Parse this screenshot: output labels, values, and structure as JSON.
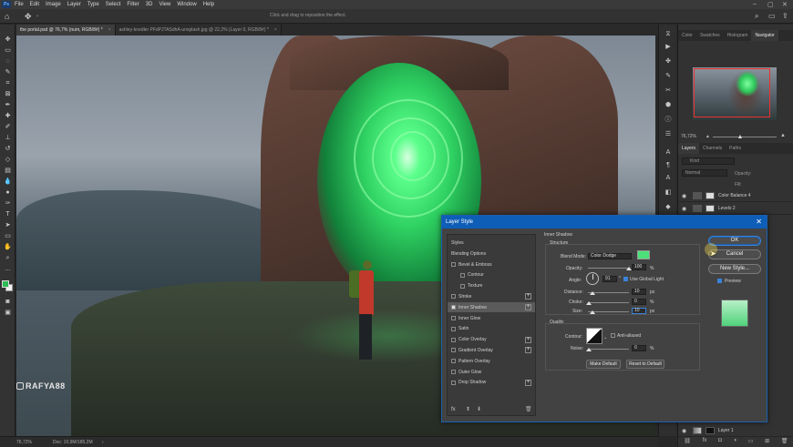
{
  "menubar": {
    "logo": "Ps",
    "items": [
      "File",
      "Edit",
      "Image",
      "Layer",
      "Type",
      "Select",
      "Filter",
      "3D",
      "View",
      "Window",
      "Help"
    ]
  },
  "options": {
    "hint": "Click and drag to reposition the effect."
  },
  "tabs": [
    {
      "label": "the portal.psd @ 76,7% (num, RGB/8#) *",
      "active": true
    },
    {
      "label": "ashley-knedler PFdPJTASdhA-unsplash.jpg @ 22,2% (Layer 0, RGB/8#) *",
      "active": false
    }
  ],
  "canvas": {
    "watermark": "RAFYA88"
  },
  "status": {
    "zoom": "76,72%",
    "doc": "Doc: 10,9M/185,2M"
  },
  "panels": {
    "top_tabs": [
      "Color",
      "Swatches",
      "Histogram",
      "Navigator"
    ],
    "nav_zoom": "76,72%",
    "layer_tabs": [
      "Layers",
      "Channels",
      "Paths"
    ],
    "search_placeholder": "Kind",
    "blend_mode": "Normal",
    "opacity_label": "Opacity:",
    "fill_label": "Fill:",
    "layers": [
      {
        "name": "Color Balance 4"
      },
      {
        "name": "Levels 2"
      },
      {
        "name": "Layer 1"
      }
    ]
  },
  "dialog": {
    "title": "Layer Style",
    "styles_header": "Styles",
    "blending_options": "Blending Options",
    "items": [
      {
        "label": "Bevel & Emboss",
        "plus": false,
        "indent": false,
        "checked": false,
        "selected": false
      },
      {
        "label": "Contour",
        "plus": false,
        "indent": true,
        "checked": false,
        "selected": false
      },
      {
        "label": "Texture",
        "plus": false,
        "indent": true,
        "checked": false,
        "selected": false
      },
      {
        "label": "Stroke",
        "plus": true,
        "indent": false,
        "checked": false,
        "selected": false
      },
      {
        "label": "Inner Shadow",
        "plus": true,
        "indent": false,
        "checked": true,
        "selected": true
      },
      {
        "label": "Inner Glow",
        "plus": false,
        "indent": false,
        "checked": false,
        "selected": false
      },
      {
        "label": "Satin",
        "plus": false,
        "indent": false,
        "checked": false,
        "selected": false
      },
      {
        "label": "Color Overlay",
        "plus": true,
        "indent": false,
        "checked": false,
        "selected": false
      },
      {
        "label": "Gradient Overlay",
        "plus": true,
        "indent": false,
        "checked": false,
        "selected": false
      },
      {
        "label": "Pattern Overlay",
        "plus": false,
        "indent": false,
        "checked": false,
        "selected": false
      },
      {
        "label": "Outer Glow",
        "plus": false,
        "indent": false,
        "checked": false,
        "selected": false
      },
      {
        "label": "Drop Shadow",
        "plus": true,
        "indent": false,
        "checked": false,
        "selected": false
      }
    ],
    "fx": "fx",
    "inner_shadow": {
      "title": "Inner Shadow",
      "structure": "Structure",
      "blend_mode_label": "Blend Mode:",
      "blend_mode": "Color Dodge",
      "color": "#4de07a",
      "opacity_label": "Opacity:",
      "opacity": "100",
      "angle_label": "Angle:",
      "angle": "91",
      "use_global_light": "Use Global Light",
      "distance_label": "Distance:",
      "distance": "10",
      "choke_label": "Choke:",
      "choke": "0",
      "size_label": "Size:",
      "size": "10",
      "unit_percent": "%",
      "unit_px": "px",
      "quality": "Quality",
      "contour_label": "Contour:",
      "anti_aliased": "Anti-aliased",
      "noise_label": "Noise:",
      "noise": "0",
      "make_default": "Make Default",
      "reset_default": "Reset to Default"
    },
    "buttons": {
      "ok": "OK",
      "cancel": "Cancel",
      "new_style": "New Style...",
      "preview": "Preview"
    }
  },
  "colors": {
    "accent_blue": "#0e5eb8",
    "fg_swatch": "#2dbb55",
    "shadow_color": "#4de07a"
  }
}
